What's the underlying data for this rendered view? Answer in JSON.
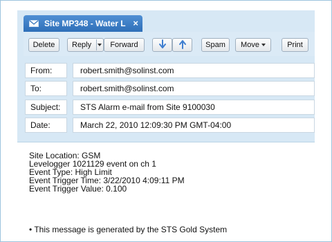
{
  "tab": {
    "title": "Site MP348 - Water L",
    "icon": "mail-icon",
    "close_label": "×"
  },
  "toolbar": {
    "delete_label": "Delete",
    "reply_label": "Reply",
    "forward_label": "Forward",
    "spam_label": "Spam",
    "move_label": "Move",
    "print_label": "Print"
  },
  "fields": [
    {
      "label": "From:",
      "value": "robert.smith@solinst.com"
    },
    {
      "label": "To:",
      "value": "robert.smith@solinst.com"
    },
    {
      "label": "Subject:",
      "value": "STS Alarm e-mail from Site 9100030"
    },
    {
      "label": "Date:",
      "value": "March 22, 2010 12:09:30 PM GMT-04:00"
    }
  ],
  "message": {
    "lines": [
      "Site Location: GSM",
      "Levelogger 1021129 event on ch 1",
      "Event Type: High Limit",
      "Event Trigger Time: 3/22/2010 4:09:11 PM",
      "Event Trigger Value: 0.100"
    ],
    "footer": "• This message is generated by the STS Gold System"
  },
  "colors": {
    "tab": "#3b7cc6",
    "toolbar_bg": "#d7e8f5",
    "arrow_blue": "#3f7fd0"
  }
}
